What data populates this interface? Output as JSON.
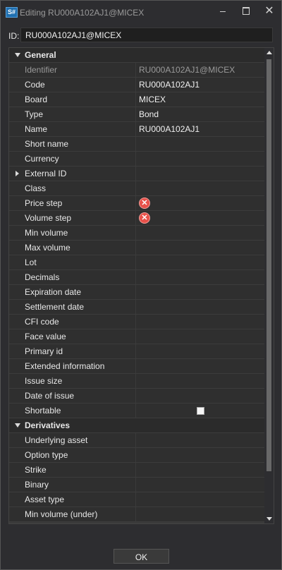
{
  "window": {
    "app_icon": "S#",
    "title": "Editing RU000A102AJ1@MICEX",
    "min_icon": "minimize-icon",
    "max_icon": "maximize-icon",
    "close_icon": "close-icon",
    "close_glyph": "✕"
  },
  "id_row": {
    "label": "ID:",
    "value": "RU000A102AJ1@MICEX"
  },
  "grid": {
    "categories": [
      "General",
      "Derivatives"
    ],
    "rows": [
      {
        "label": "General"
      },
      {
        "label": "Identifier",
        "value": "RU000A102AJ1@MICEX"
      },
      {
        "label": "Code",
        "value": "RU000A102AJ1"
      },
      {
        "label": "Board",
        "value": "MICEX"
      },
      {
        "label": "Type",
        "value": "Bond"
      },
      {
        "label": "Name",
        "value": "RU000A102AJ1"
      },
      {
        "label": "Short name",
        "value": ""
      },
      {
        "label": "Currency",
        "value": ""
      },
      {
        "label": "External ID",
        "value": ""
      },
      {
        "label": "Class",
        "value": ""
      },
      {
        "label": "Price step",
        "icon": "error-icon",
        "glyph": "✕"
      },
      {
        "label": "Volume step",
        "icon": "error-icon",
        "glyph": "✕"
      },
      {
        "label": "Min volume",
        "value": ""
      },
      {
        "label": "Max volume",
        "value": ""
      },
      {
        "label": "Lot",
        "value": ""
      },
      {
        "label": "Decimals",
        "value": ""
      },
      {
        "label": "Expiration date",
        "value": ""
      },
      {
        "label": "Settlement date",
        "value": ""
      },
      {
        "label": "CFI code",
        "value": ""
      },
      {
        "label": "Face value",
        "value": ""
      },
      {
        "label": "Primary id",
        "value": ""
      },
      {
        "label": "Extended information",
        "value": ""
      },
      {
        "label": "Issue size",
        "value": ""
      },
      {
        "label": "Date of issue",
        "value": ""
      },
      {
        "label": "Shortable",
        "checked": false
      },
      {
        "label": "Derivatives"
      },
      {
        "label": "Underlying asset",
        "value": ""
      },
      {
        "label": "Option type",
        "value": ""
      },
      {
        "label": "Strike",
        "value": ""
      },
      {
        "label": "Binary",
        "value": ""
      },
      {
        "label": "Asset type",
        "value": ""
      },
      {
        "label": "Min volume (under)",
        "value": ""
      }
    ]
  },
  "ok_button": "OK",
  "colors": {
    "error": "#e8514a",
    "background": "#2d2d30",
    "row": "#2f2f2f"
  }
}
